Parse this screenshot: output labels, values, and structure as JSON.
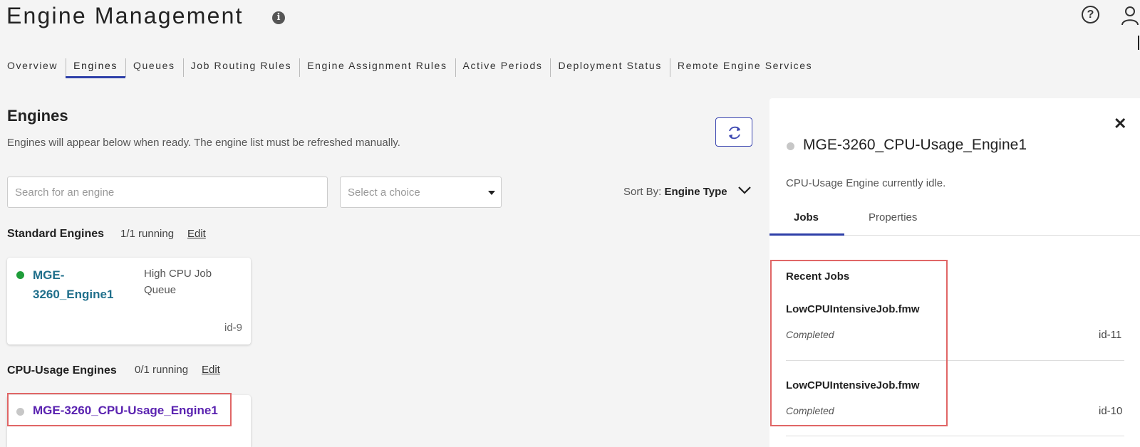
{
  "header": {
    "title": "Engine Management",
    "info_icon": "info-icon",
    "help_icon": "help-icon",
    "user_icon": "user-icon"
  },
  "tabs": [
    {
      "label": "Overview",
      "active": false
    },
    {
      "label": "Engines",
      "active": true
    },
    {
      "label": "Queues",
      "active": false
    },
    {
      "label": "Job Routing Rules",
      "active": false
    },
    {
      "label": "Engine Assignment Rules",
      "active": false
    },
    {
      "label": "Active Periods",
      "active": false
    },
    {
      "label": "Deployment Status",
      "active": false
    },
    {
      "label": "Remote Engine Services",
      "active": false
    }
  ],
  "main": {
    "title": "Engines",
    "description": "Engines will appear below when ready. The engine list must be refreshed manually.",
    "refresh_icon": "refresh-icon",
    "search": {
      "placeholder": "Search for an engine",
      "value": ""
    },
    "select": {
      "placeholder": "Select a choice"
    },
    "sort": {
      "label": "Sort By:",
      "value": "Engine Type"
    }
  },
  "groups": {
    "standard": {
      "title": "Standard Engines",
      "count": "1/1 running",
      "edit": "Edit",
      "engine": {
        "name_line1": "MGE-",
        "name_line2": "3260_Engine1",
        "queue_line1": "High CPU Job",
        "queue_line2": "Queue",
        "id": "id-9",
        "status_color": "#1f9d3a"
      }
    },
    "cpu": {
      "title": "CPU-Usage Engines",
      "count": "0/1 running",
      "edit": "Edit",
      "engine": {
        "name": "MGE-3260_CPU-Usage_Engine1",
        "status_color": "#c7c7c7"
      }
    }
  },
  "panel": {
    "title": "MGE-3260_CPU-Usage_Engine1",
    "status": "CPU-Usage Engine currently idle.",
    "close_icon": "close-icon",
    "tabs": [
      {
        "label": "Jobs",
        "active": true
      },
      {
        "label": "Properties",
        "active": false
      }
    ],
    "recent_title": "Recent Jobs",
    "jobs": [
      {
        "name": "LowCPUIntensiveJob.fmw",
        "status": "Completed",
        "id": "id-11"
      },
      {
        "name": "LowCPUIntensiveJob.fmw",
        "status": "Completed",
        "id": "id-10"
      }
    ]
  },
  "colors": {
    "accent": "#2e3fa8",
    "highlight": "#e06666",
    "link_teal": "#1f6f8b",
    "link_purple": "#5a22b0"
  }
}
